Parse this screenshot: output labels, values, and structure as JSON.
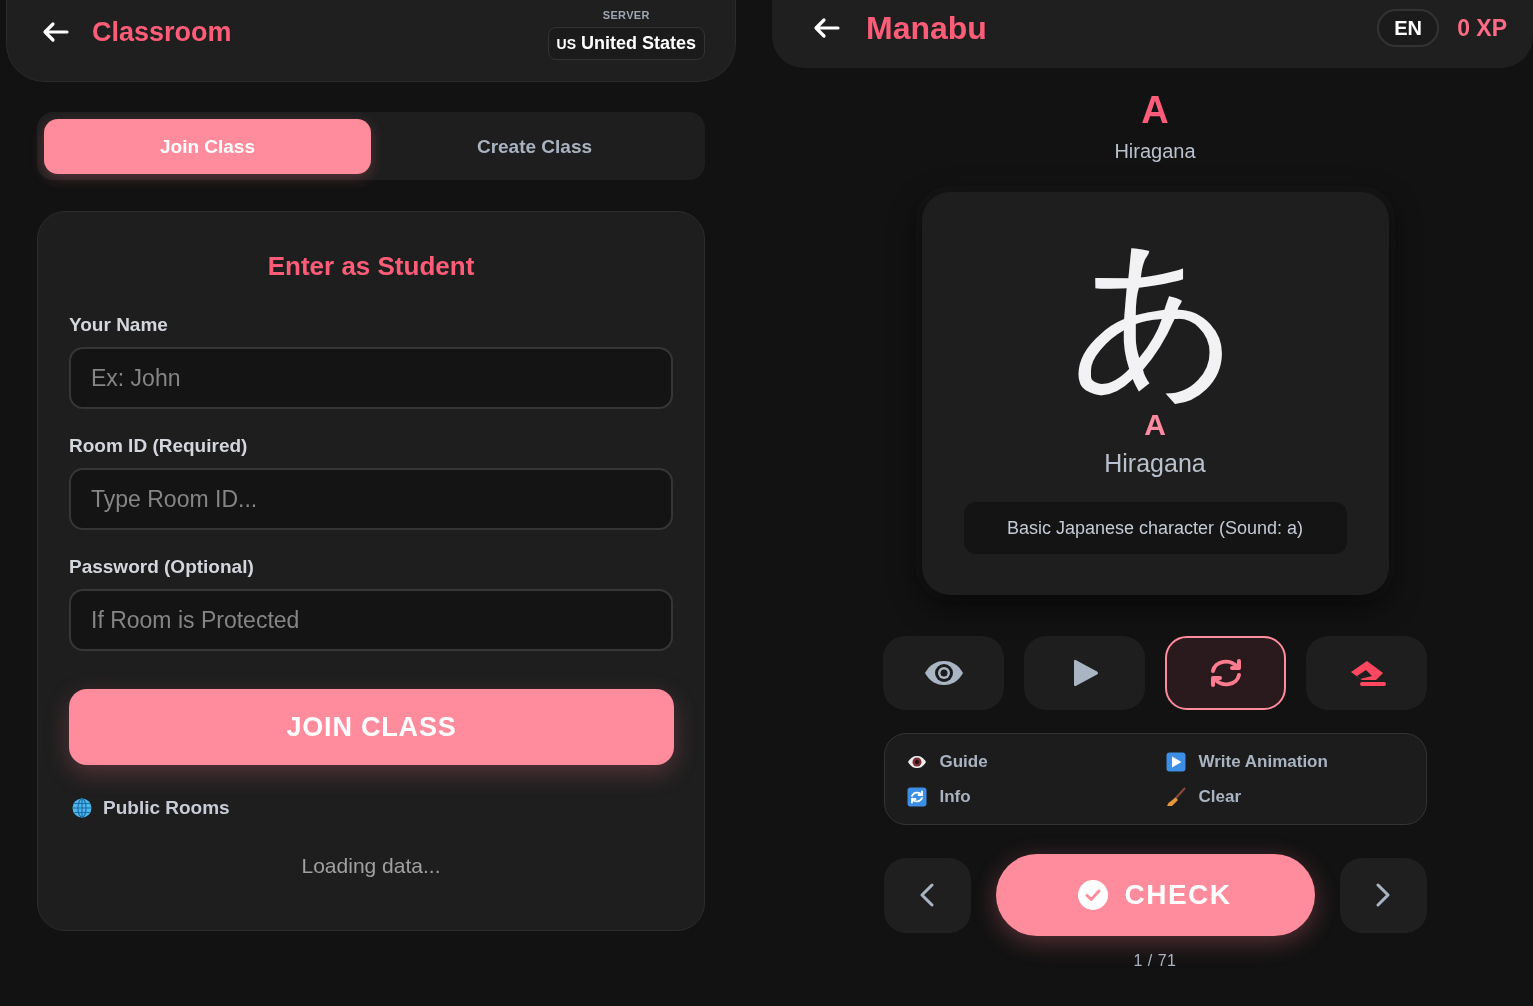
{
  "classroom": {
    "header": {
      "title": "Classroom",
      "server": {
        "label": "SERVER",
        "flag": "US",
        "value": "United States"
      }
    },
    "tabs": [
      {
        "label": "Join Class",
        "selected": true
      },
      {
        "label": "Create Class",
        "selected": false
      }
    ],
    "form": {
      "title": "Enter as Student",
      "fields": [
        {
          "label": "Your Name",
          "placeholder": "Ex: John"
        },
        {
          "label": "Room ID (Required)",
          "placeholder": "Type Room ID..."
        },
        {
          "label": "Password (Optional)",
          "placeholder": "If Room is Protected"
        }
      ],
      "submit": "JOIN CLASS"
    },
    "public_rooms": {
      "title": "Public Rooms",
      "status": "Loading data..."
    }
  },
  "practice": {
    "header": {
      "title": "Manabu",
      "language": "EN",
      "xp": "0 XP"
    },
    "romaji": "A",
    "script": "Hiragana",
    "card": {
      "character": "あ",
      "romaji": "A",
      "script": "Hiragana",
      "description": "Basic Japanese character (Sound: a)"
    },
    "tools": [
      {
        "selected": false
      },
      {
        "selected": false
      },
      {
        "selected": true
      },
      {
        "selected": false
      }
    ],
    "legend": [
      {
        "label": "Guide"
      },
      {
        "label": "Write Animation"
      },
      {
        "label": "Info"
      },
      {
        "label": "Clear"
      }
    ],
    "check": "CHECK",
    "progress": "1 / 71"
  }
}
